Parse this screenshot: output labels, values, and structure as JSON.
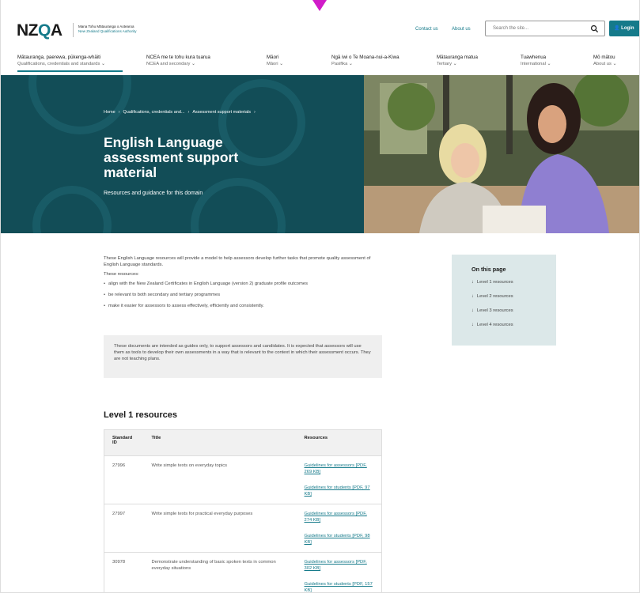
{
  "brand": {
    "logo_left": "NZ",
    "logo_q": "Q",
    "logo_right": "A",
    "tagline_mi": "Mana Tohu Mātauranga o Aotearoa",
    "tagline_en": "New Zealand Qualifications Authority",
    "accent_color": "#157a8a",
    "hero_color": "#124d57"
  },
  "header": {
    "contact_label": "Contact us",
    "about_label": "About us",
    "search_placeholder": "Search the site...",
    "login_label": "Login"
  },
  "nav": [
    {
      "label": "Mātauranga, paerewa, pūkenga-whāiti",
      "sub": "Qualifications, credentials and standards ⌄"
    },
    {
      "label": "NCEA me te tohu kura tuarua",
      "sub": "NCEA and secondary ⌄"
    },
    {
      "label": "Māori",
      "sub": "Māori ⌄"
    },
    {
      "label": "Ngā iwi o Te Moana-nui-a-Kiwa",
      "sub": "Pasifika ⌄"
    },
    {
      "label": "Mātauranga matua",
      "sub": "Tertiary ⌄"
    },
    {
      "label": "Tuawhenua",
      "sub": "International ⌄"
    },
    {
      "label": "Mō mātou",
      "sub": "About us ⌄"
    }
  ],
  "breadcrumb": [
    "Home",
    "›",
    "Qualifications, credentials and...",
    "›",
    "Assessment support materials",
    "›"
  ],
  "hero": {
    "title": "English Language assessment support material",
    "subtitle": "Resources and guidance for this domain"
  },
  "intro": {
    "p1": "These English Language resources will provide a model to help assessors develop further tasks that promote quality assessment of English Language standards.",
    "p2": "These resources:",
    "bullets": [
      "align with the New Zealand Certificates in English Language (version 2) graduate profile outcomes",
      "be relevant to both secondary and tertiary programmes",
      "make it easier for assessors to assess effectively, efficiently and consistently."
    ]
  },
  "note": "These documents are intended as guides only, to support assessors and candidates. It is expected that assessors will use them as tools to develop their own assessments in a way that is relevant to the context in which their assessment occurs. They are not teaching plans.",
  "toc": {
    "title": "On this page",
    "items": [
      "Level 1 resources",
      "Level 2 resources",
      "Level 3 resources",
      "Level 4 resources"
    ]
  },
  "level1": {
    "title": "Level 1 resources",
    "headers": [
      "Standard ID",
      "Title",
      "Resources"
    ],
    "rows": [
      {
        "id": "27996",
        "title": "Write simple texts on everyday topics",
        "r1": "Guidelines for assessors [PDF, 269 KB]",
        "r2": "Guidelines for students [PDF, 97 KB]"
      },
      {
        "id": "27997",
        "title": "Write simple texts for practical everyday purposes",
        "r1": "Guidelines for assessors [PDF, 274 KB]",
        "r2": "Guidelines for students [PDF, 98 KB]"
      },
      {
        "id": "30978",
        "title": "Demonstrate understanding of basic spoken texts in common everyday situations",
        "r1": "Guidelines for assessors [PDF, 302 KB]",
        "r2": "Guidelines for students [PDF, 157 KB]"
      }
    ]
  }
}
